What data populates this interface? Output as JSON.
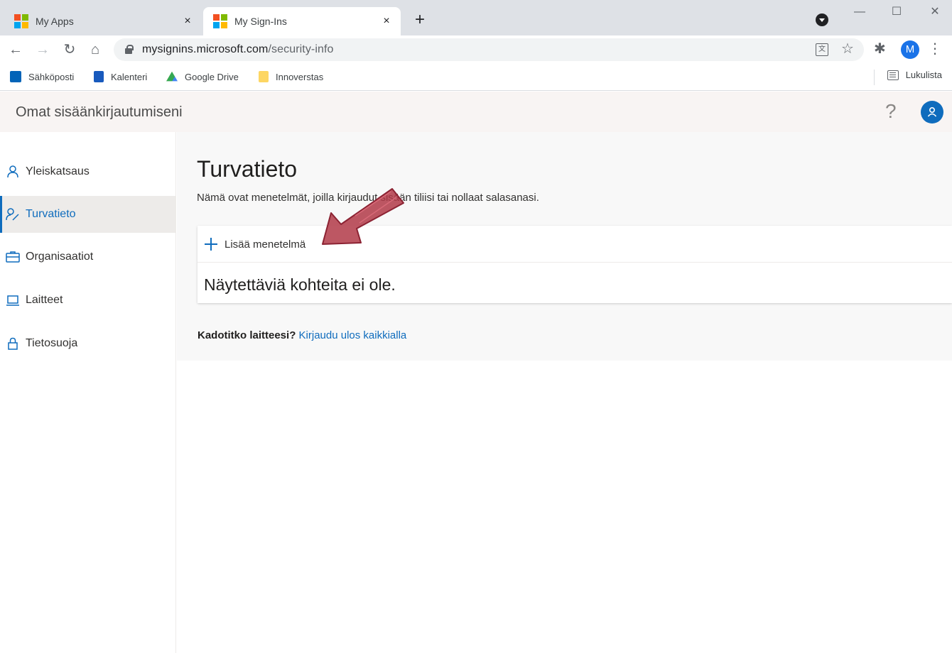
{
  "browser": {
    "tabs": [
      {
        "title": "My Apps",
        "close": "×"
      },
      {
        "title": "My Sign-Ins",
        "close": "×"
      }
    ],
    "new_tab": "+",
    "window_controls": {
      "minimize": "—",
      "maximize": "☐",
      "close": "✕"
    },
    "toolbar": {
      "back": "←",
      "forward": "→",
      "reload": "↻",
      "home": "⌂",
      "url_domain": "mysignins.microsoft.com",
      "url_path": "/security-info",
      "translate": "文",
      "star": "☆",
      "extensions": "✱",
      "profile_initial": "M",
      "menu": "⋮"
    },
    "bookmarks": [
      {
        "label": "Sähköposti",
        "icon": "outlook-icon",
        "color": "#0364b8"
      },
      {
        "label": "Kalenteri",
        "icon": "calendar-icon",
        "color": "#185abd"
      },
      {
        "label": "Google Drive",
        "icon": "google-drive-icon",
        "color": "#34a853"
      },
      {
        "label": "Innoverstas",
        "icon": "folder-icon",
        "color": "#fdd663"
      }
    ],
    "reading_list": "Lukulista"
  },
  "app": {
    "title": "Omat sisäänkirjautumiseni",
    "help": "?"
  },
  "sidebar": {
    "items": [
      {
        "label": "Yleiskatsaus",
        "icon": "person-icon",
        "selected": false
      },
      {
        "label": "Turvatieto",
        "icon": "security-info-icon",
        "selected": true
      },
      {
        "label": "Organisaatiot",
        "icon": "briefcase-icon",
        "selected": false
      },
      {
        "label": "Laitteet",
        "icon": "laptop-icon",
        "selected": false
      },
      {
        "label": "Tietosuoja",
        "icon": "lock-icon",
        "selected": false
      }
    ]
  },
  "main": {
    "title": "Turvatieto",
    "description": "Nämä ovat menetelmät, joilla kirjaudut sisään tiliisi tai nollaat salasanasi.",
    "add_method": "Lisää menetelmä",
    "empty_message": "Näytettäviä kohteita ei ole.",
    "lost_device_label": "Kadotitko laitteesi?",
    "lost_device_link": "Kirjaudu ulos kaikkialla"
  },
  "colors": {
    "accent": "#0f6cbd",
    "annotation_arrow": "#b23a48"
  }
}
